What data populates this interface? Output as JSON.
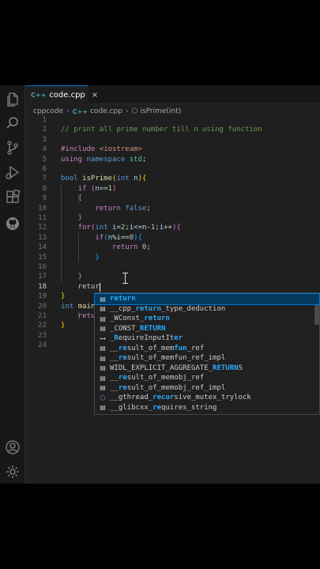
{
  "tab": {
    "icon": "C++",
    "name": "code.cpp",
    "close": "×"
  },
  "breadcrumb": {
    "folder": "cppcode",
    "sep": "›",
    "file": "code.cpp",
    "symbol": "isPrime(int)"
  },
  "activity_icons": [
    "files-icon",
    "search-icon",
    "source-control-icon",
    "run-debug-icon",
    "extensions-icon",
    "github-icon",
    "account-icon",
    "settings-gear-icon"
  ],
  "code_lines": [
    {
      "n": "1",
      "segs": []
    },
    {
      "n": "2",
      "segs": [
        {
          "t": "// print all prime number till n using function",
          "c": "c-com"
        }
      ]
    },
    {
      "n": "3",
      "segs": []
    },
    {
      "n": "4",
      "segs": [
        {
          "t": "#include ",
          "c": "c-ctl"
        },
        {
          "t": "<iostream>",
          "c": "c-str"
        }
      ]
    },
    {
      "n": "5",
      "segs": [
        {
          "t": "using ",
          "c": "c-ctl"
        },
        {
          "t": "namespace ",
          "c": "c-kw"
        },
        {
          "t": "std",
          "c": "c-ty"
        },
        {
          "t": ";",
          "c": ""
        }
      ]
    },
    {
      "n": "6",
      "segs": []
    },
    {
      "n": "7",
      "segs": [
        {
          "t": "bool ",
          "c": "c-kw"
        },
        {
          "t": "isPrime",
          "c": "c-fn"
        },
        {
          "t": "(",
          "c": "c-br1"
        },
        {
          "t": "int ",
          "c": "c-kw"
        },
        {
          "t": "n",
          "c": "c-var"
        },
        {
          "t": ")",
          "c": "c-br1"
        },
        {
          "t": "{",
          "c": "c-br1"
        }
      ]
    },
    {
      "n": "8",
      "segs": [
        {
          "t": "    if ",
          "c": "c-ctl"
        },
        {
          "t": "(",
          "c": "c-br2"
        },
        {
          "t": "n",
          "c": "c-var"
        },
        {
          "t": "==",
          "c": ""
        },
        {
          "t": "1",
          "c": "c-num"
        },
        {
          "t": ")",
          "c": "c-br2"
        }
      ]
    },
    {
      "n": "9",
      "segs": [
        {
          "t": "    {",
          "c": "c-br2"
        }
      ]
    },
    {
      "n": "10",
      "segs": [
        {
          "t": "        return ",
          "c": "c-ctl"
        },
        {
          "t": "false",
          "c": "c-kw"
        },
        {
          "t": ";",
          "c": ""
        }
      ]
    },
    {
      "n": "11",
      "segs": [
        {
          "t": "    }",
          "c": "c-br2"
        }
      ]
    },
    {
      "n": "12",
      "segs": [
        {
          "t": "    for",
          "c": "c-ctl"
        },
        {
          "t": "(",
          "c": "c-br2"
        },
        {
          "t": "int ",
          "c": "c-kw"
        },
        {
          "t": "i",
          "c": "c-var"
        },
        {
          "t": "=",
          "c": ""
        },
        {
          "t": "2",
          "c": "c-num"
        },
        {
          "t": ";",
          "c": ""
        },
        {
          "t": "i",
          "c": "c-var"
        },
        {
          "t": "<=",
          "c": ""
        },
        {
          "t": "n",
          "c": "c-var"
        },
        {
          "t": "-",
          "c": ""
        },
        {
          "t": "1",
          "c": "c-num"
        },
        {
          "t": ";",
          "c": ""
        },
        {
          "t": "i",
          "c": "c-var"
        },
        {
          "t": "++",
          "c": ""
        },
        {
          "t": ")",
          "c": "c-br2"
        },
        {
          "t": "{",
          "c": "c-br2"
        }
      ]
    },
    {
      "n": "13",
      "segs": [
        {
          "t": "        if",
          "c": "c-ctl"
        },
        {
          "t": "(",
          "c": "c-br3"
        },
        {
          "t": "n",
          "c": "c-var"
        },
        {
          "t": "%",
          "c": ""
        },
        {
          "t": "i",
          "c": "c-var"
        },
        {
          "t": "==",
          "c": ""
        },
        {
          "t": "0",
          "c": "c-num"
        },
        {
          "t": ")",
          "c": "c-br3"
        },
        {
          "t": "{",
          "c": "c-br3"
        }
      ]
    },
    {
      "n": "14",
      "segs": [
        {
          "t": "            return ",
          "c": "c-ctl"
        },
        {
          "t": "0",
          "c": "c-num"
        },
        {
          "t": ";",
          "c": ""
        }
      ]
    },
    {
      "n": "15",
      "segs": [
        {
          "t": "        }",
          "c": "c-br3"
        }
      ]
    },
    {
      "n": "16",
      "segs": []
    },
    {
      "n": "17",
      "segs": [
        {
          "t": "    }",
          "c": "c-br2"
        }
      ]
    },
    {
      "n": "18",
      "segs": [
        {
          "t": "    retur",
          "c": ""
        }
      ]
    },
    {
      "n": "19",
      "segs": [
        {
          "t": "}",
          "c": "c-br1"
        }
      ]
    },
    {
      "n": "20",
      "segs": [
        {
          "t": "int ",
          "c": "c-kw"
        },
        {
          "t": "main",
          "c": "c-fn"
        },
        {
          "t": "(",
          "c": "c-br1"
        }
      ]
    },
    {
      "n": "21",
      "segs": [
        {
          "t": "    retur",
          "c": "c-ctl"
        }
      ]
    },
    {
      "n": "22",
      "segs": [
        {
          "t": "}",
          "c": "c-br1"
        }
      ]
    },
    {
      "n": "23",
      "segs": []
    },
    {
      "n": "24",
      "segs": []
    }
  ],
  "suggestions": [
    {
      "icon": "kw",
      "pre": "",
      "match": "return",
      "post": ""
    },
    {
      "icon": "kw",
      "pre": "__cpp_",
      "match": "return",
      "post": "_type_deduction"
    },
    {
      "icon": "kw",
      "pre": "_WConst_",
      "match": "return",
      "post": ""
    },
    {
      "icon": "kw",
      "pre": "_CONST_",
      "match": "RETURN",
      "post": ""
    },
    {
      "icon": "kw",
      "pre": "_",
      "match": "R",
      "post": "equireInputIt",
      "match2": "er",
      "post2": ""
    },
    {
      "icon": "kw",
      "pre": "__",
      "match": "re",
      "post": "sult_of_mem",
      "match2": "fun",
      "post2": "_ref"
    },
    {
      "icon": "kw",
      "pre": "__",
      "match": "re",
      "post": "sult_of_memfun_ref_impl"
    },
    {
      "icon": "kw",
      "pre": "WIDL_EXPLICIT_AGGREGATE_",
      "match": "RETURN",
      "post": "S"
    },
    {
      "icon": "kw",
      "pre": "__",
      "match": "re",
      "post": "sult_of_memobj_ref"
    },
    {
      "icon": "kw",
      "pre": "__",
      "match": "re",
      "post": "sult_of_memobj_ref_impl"
    },
    {
      "icon": "fn",
      "pre": "__gthread_",
      "match": "recur",
      "post": "sive_mutex_trylock"
    },
    {
      "icon": "kw",
      "pre": "__glibcxx_",
      "match": "re",
      "post": "quires_string"
    }
  ]
}
